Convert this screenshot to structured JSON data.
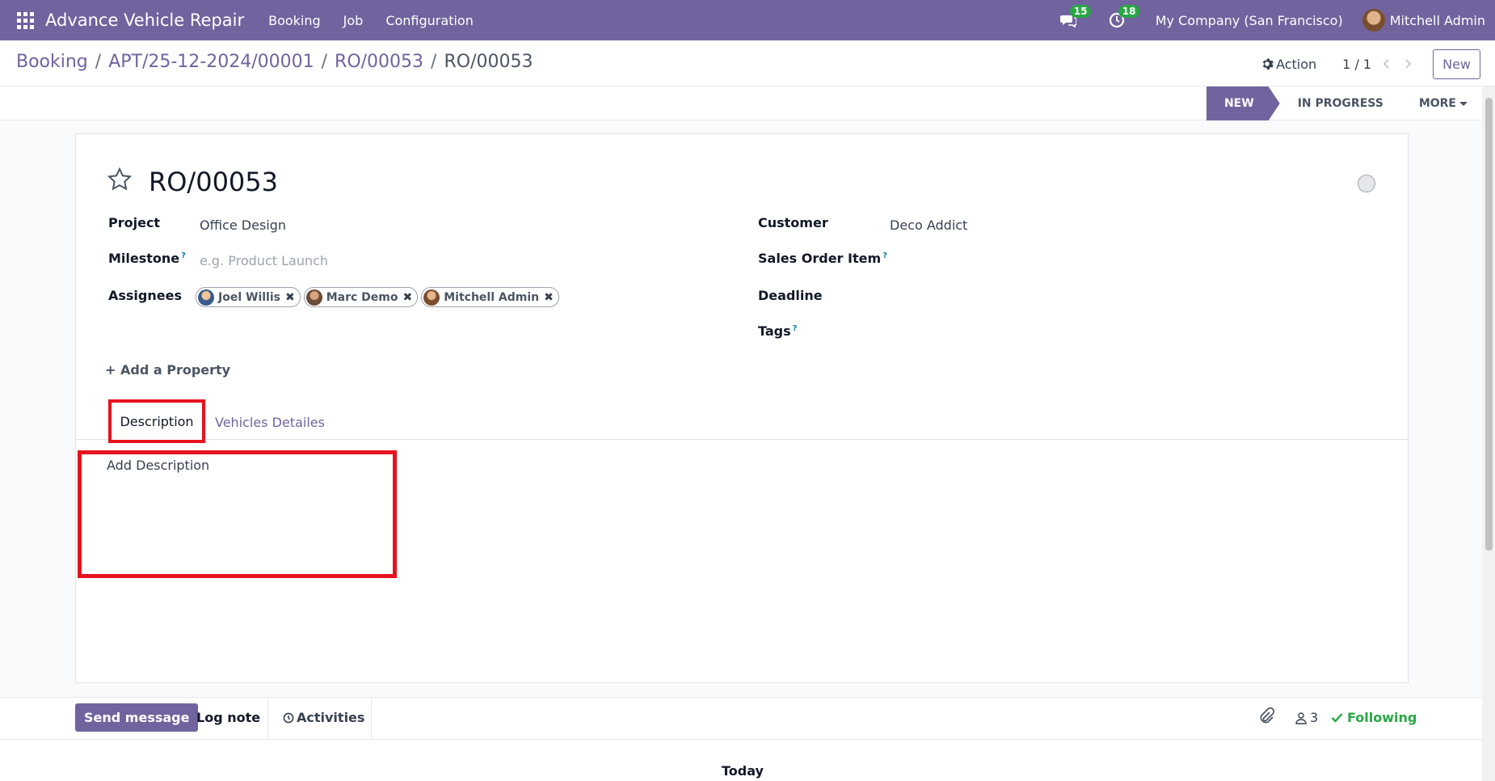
{
  "navbar": {
    "app_name": "Advance Vehicle Repair",
    "menu": [
      "Booking",
      "Job",
      "Configuration"
    ],
    "messages_count": "15",
    "activities_count": "18",
    "company": "My Company (San Francisco)",
    "user": "Mitchell Admin"
  },
  "control_panel": {
    "breadcrumb": [
      "Booking",
      "APT/25-12-2024/00001",
      "RO/00053"
    ],
    "current": "RO/00053",
    "separator": "/",
    "action_label": "Action",
    "pager": "1 / 1",
    "new_label": "New"
  },
  "statusbar": {
    "stages": [
      "NEW",
      "IN PROGRESS"
    ],
    "more_label": "MORE"
  },
  "form": {
    "title": "RO/00053",
    "left_fields": {
      "project_label": "Project",
      "project_value": "Office Design",
      "milestone_label": "Milestone",
      "milestone_placeholder": "e.g. Product Launch",
      "assignees_label": "Assignees",
      "assignees": [
        "Joel Willis",
        "Marc Demo",
        "Mitchell Admin"
      ]
    },
    "right_fields": {
      "customer_label": "Customer",
      "customer_value": "Deco Addict",
      "sales_order_item_label": "Sales Order Item",
      "deadline_label": "Deadline",
      "tags_label": "Tags"
    },
    "help_marker": "?",
    "add_property_label": "Add a Property",
    "tabs": [
      "Description",
      "Vehicles Detailes"
    ],
    "description_placeholder": "Add Description"
  },
  "chatter": {
    "send_message": "Send message",
    "log_note": "Log note",
    "activities": "Activities",
    "followers_count": "3",
    "following": "Following",
    "today": "Today"
  },
  "colors": {
    "brand": "#71639e",
    "highlight": "#e5131d",
    "badge": "#28a745",
    "following": "#28a745"
  }
}
